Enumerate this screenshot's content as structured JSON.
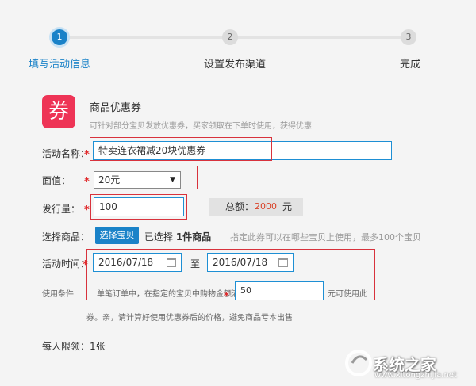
{
  "steps": [
    {
      "number": "1",
      "label": "填写活动信息"
    },
    {
      "number": "2",
      "label": "设置发布渠道"
    },
    {
      "number": "3",
      "label": "完成"
    }
  ],
  "coupon": {
    "icon_char": "券",
    "title": "商品优惠券",
    "description": "可针对部分宝贝发放优惠券，买家领取在下单时使用，获得优惠"
  },
  "form": {
    "activity_name_label": "活动名称：",
    "activity_name_value": "特卖连衣裙减20块优惠券",
    "face_value_label": "面值：",
    "face_value_selected": "20元",
    "quantity_label": "发行量：",
    "quantity_value": "100",
    "total_label": "总额：",
    "total_value": "2000",
    "total_unit": "元",
    "select_goods_label": "选择商品：",
    "select_goods_button": "选择宝贝",
    "selected_prefix": "已选择 ",
    "selected_count": "1件商品",
    "select_hint": "指定此券可以在哪些宝贝上使用，最多100个宝贝",
    "time_label": "活动时间：",
    "start_date": "2016/07/18",
    "to_label": "至",
    "end_date": "2016/07/18",
    "condition_label": "使用条件",
    "condition_text": "单笔订单中，在指定的宝贝中购物金额满",
    "condition_value": "50",
    "condition_suffix": "元可使用此",
    "condition_note": "券。亲，请计算好使用优惠券后的价格，避免商品亏本出售",
    "limit_label": "每人限领：",
    "limit_value": "1张",
    "required_mark": "*"
  },
  "watermark": {
    "text": "系统之家",
    "url": "www.xitongzhijia.net"
  }
}
